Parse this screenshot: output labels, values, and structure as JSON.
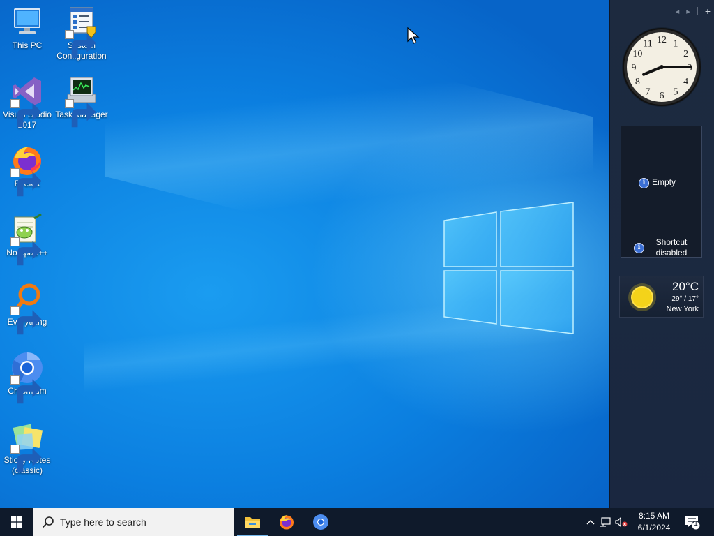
{
  "desktop": {
    "icons": [
      {
        "label": "This PC",
        "icon": "this-pc-icon",
        "shortcut": false
      },
      {
        "label": "System Configuration",
        "icon": "system-configuration-icon",
        "shortcut": true
      },
      {
        "label": "Visual Studio 2017",
        "icon": "visual-studio-icon",
        "shortcut": true
      },
      {
        "label": "Task Manager",
        "icon": "task-manager-icon",
        "shortcut": true
      },
      {
        "label": "Firefox",
        "icon": "firefox-icon",
        "shortcut": true
      },
      {
        "label": "Notepad++",
        "icon": "notepad-plus-plus-icon",
        "shortcut": true
      },
      {
        "label": "Everything",
        "icon": "everything-icon",
        "shortcut": true
      },
      {
        "label": "Chromium",
        "icon": "chromium-icon",
        "shortcut": true
      },
      {
        "label": "Sticky Notes (classic)",
        "icon": "sticky-notes-icon",
        "shortcut": true
      }
    ]
  },
  "sidebar": {
    "controls": {
      "prev": "◂",
      "next": "▸",
      "add": "+"
    },
    "clock": {
      "hour": 8,
      "minute": 15
    },
    "slideshow": {
      "status": "Empty",
      "shortcut_status": "Shortcut disabled"
    },
    "weather": {
      "temperature": "20°C",
      "range": "29° / 17°",
      "city": "New York"
    }
  },
  "taskbar": {
    "search_placeholder": "Type here to search",
    "pinned": [
      "file-explorer-icon",
      "firefox-icon",
      "chromium-icon"
    ],
    "tray_icons": [
      "chevron-up-icon",
      "network-icon",
      "volume-muted-icon"
    ],
    "time": "8:15 AM",
    "date": "6/1/2024",
    "notification_count": "1"
  },
  "colors": {
    "taskbar": "#0f1a2b",
    "sidebar": "#1d2a3f",
    "wallpaper": "#0b7fe0"
  }
}
